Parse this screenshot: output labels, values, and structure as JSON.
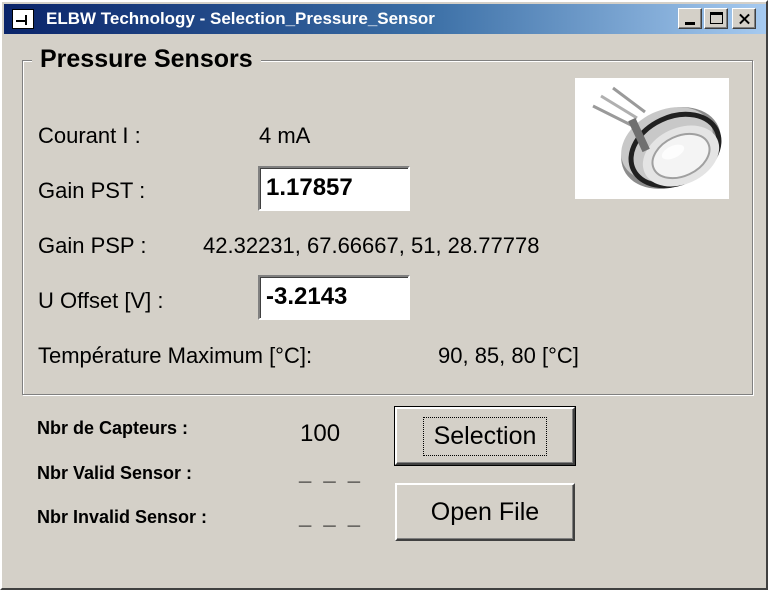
{
  "window": {
    "title": "ELBW Technology - Selection_Pressure_Sensor"
  },
  "group": {
    "title": "Pressure Sensors"
  },
  "fields": {
    "courant_label": "Courant  I :",
    "courant_value": "4 mA",
    "gain_pst_label": "Gain PST :",
    "gain_pst_value": "1.17857",
    "gain_psp_label": "Gain PSP :",
    "gain_psp_values": "42.32231,   67.66667,   51,   28.77778",
    "u_offset_label": "U Offset [V] :",
    "u_offset_value": "-3.2143",
    "temp_label": "Température Maximum [°C]:",
    "temp_values": "90,   85,   80  [°C]"
  },
  "counts": {
    "capteurs_label": "Nbr de Capteurs :",
    "capteurs_value": "100",
    "valid_label": "Nbr Valid Sensor :",
    "valid_value": "_ _ _",
    "invalid_label": "Nbr Invalid Sensor :",
    "invalid_value": "_ _ _"
  },
  "buttons": {
    "selection": "Selection",
    "open_file": "Open File"
  },
  "icons": {
    "app": "app-icon",
    "minimize": "minimize-icon",
    "maximize": "maximize-icon",
    "close": "close-icon"
  },
  "colors": {
    "titlebar_start": "#0a246a",
    "titlebar_end": "#a6caf0",
    "face": "#d4d0c8"
  }
}
